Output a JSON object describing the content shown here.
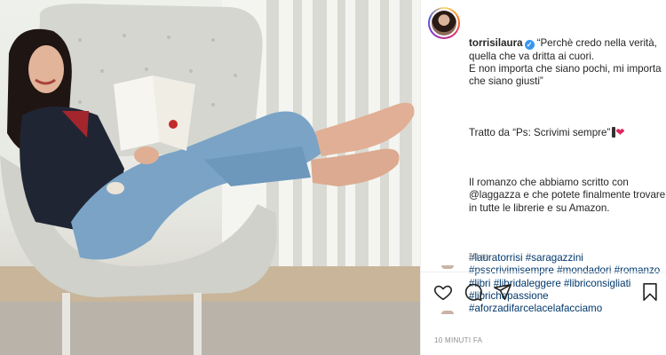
{
  "post": {
    "username": "torrisilaura",
    "caption": {
      "quote": "“Perchè credo nella verità, quella che va dritta ai cuori.\nE non importa che siano pochi, mi importa che siano giusti”",
      "source": "Tratto da “Ps: Scrivimi sempre”",
      "body": "Il romanzo che abbiamo scritto con @laggazza e che potete finalmente trovare in tutte le librerie e su Amazon.",
      "hashtags": "#lauratorrisi #saragazzini #psscrivimisempre #mondadori #romanzo #libri #libridaleggere #libriconsigliati #librichepassione #aforzadifarcelacelafacciamo"
    },
    "caption_time": "10 m",
    "posted_time": "10 MINUTI FA"
  },
  "icons": {
    "verified": "verified-badge-icon",
    "like": "heart-icon",
    "comment": "comment-icon",
    "share": "paper-plane-icon",
    "save": "bookmark-icon"
  },
  "colors": {
    "text": "#262626",
    "muted": "#8e8e8e",
    "hashtag": "#00376b",
    "verified": "#3897f0"
  }
}
